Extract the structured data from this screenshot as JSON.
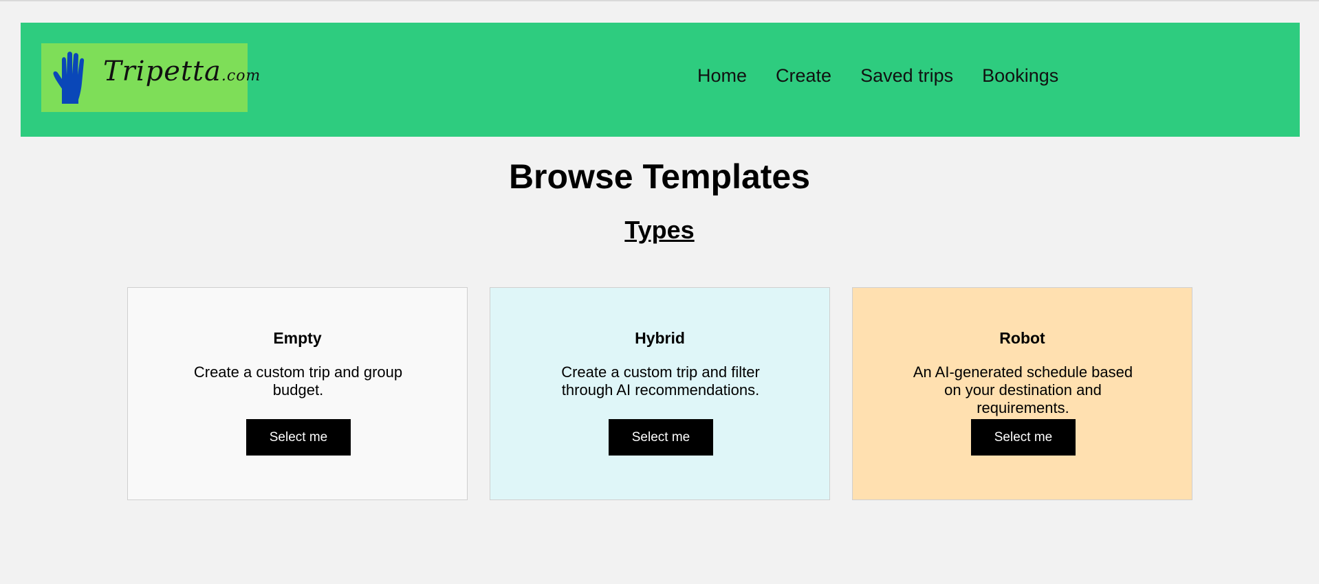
{
  "colors": {
    "page_background": "#f2f2f2",
    "header_background": "#2ecc7f",
    "logo_background": "#7ede58",
    "logo_hand": "#0a47b8",
    "button_background": "#000000",
    "button_text": "#ffffff"
  },
  "header": {
    "logo": {
      "icon": "raised-hand-icon",
      "text_main": "Tripetta",
      "text_suffix": ".com"
    },
    "nav": [
      {
        "label": "Home"
      },
      {
        "label": "Create"
      },
      {
        "label": "Saved trips"
      },
      {
        "label": "Bookings"
      }
    ]
  },
  "main": {
    "title": "Browse Templates",
    "section_title": "Types",
    "cards": [
      {
        "title": "Empty",
        "description": "Create a custom trip and group budget.",
        "button_label": "Select me",
        "background": "#f9f9f9"
      },
      {
        "title": "Hybrid",
        "description": "Create a custom trip and filter through AI recommendations.",
        "button_label": "Select me",
        "background": "#dff6f8"
      },
      {
        "title": "Robot",
        "description": "An AI-generated schedule based on your destination and requirements.",
        "button_label": "Select me",
        "background": "#ffe0b0"
      }
    ]
  }
}
